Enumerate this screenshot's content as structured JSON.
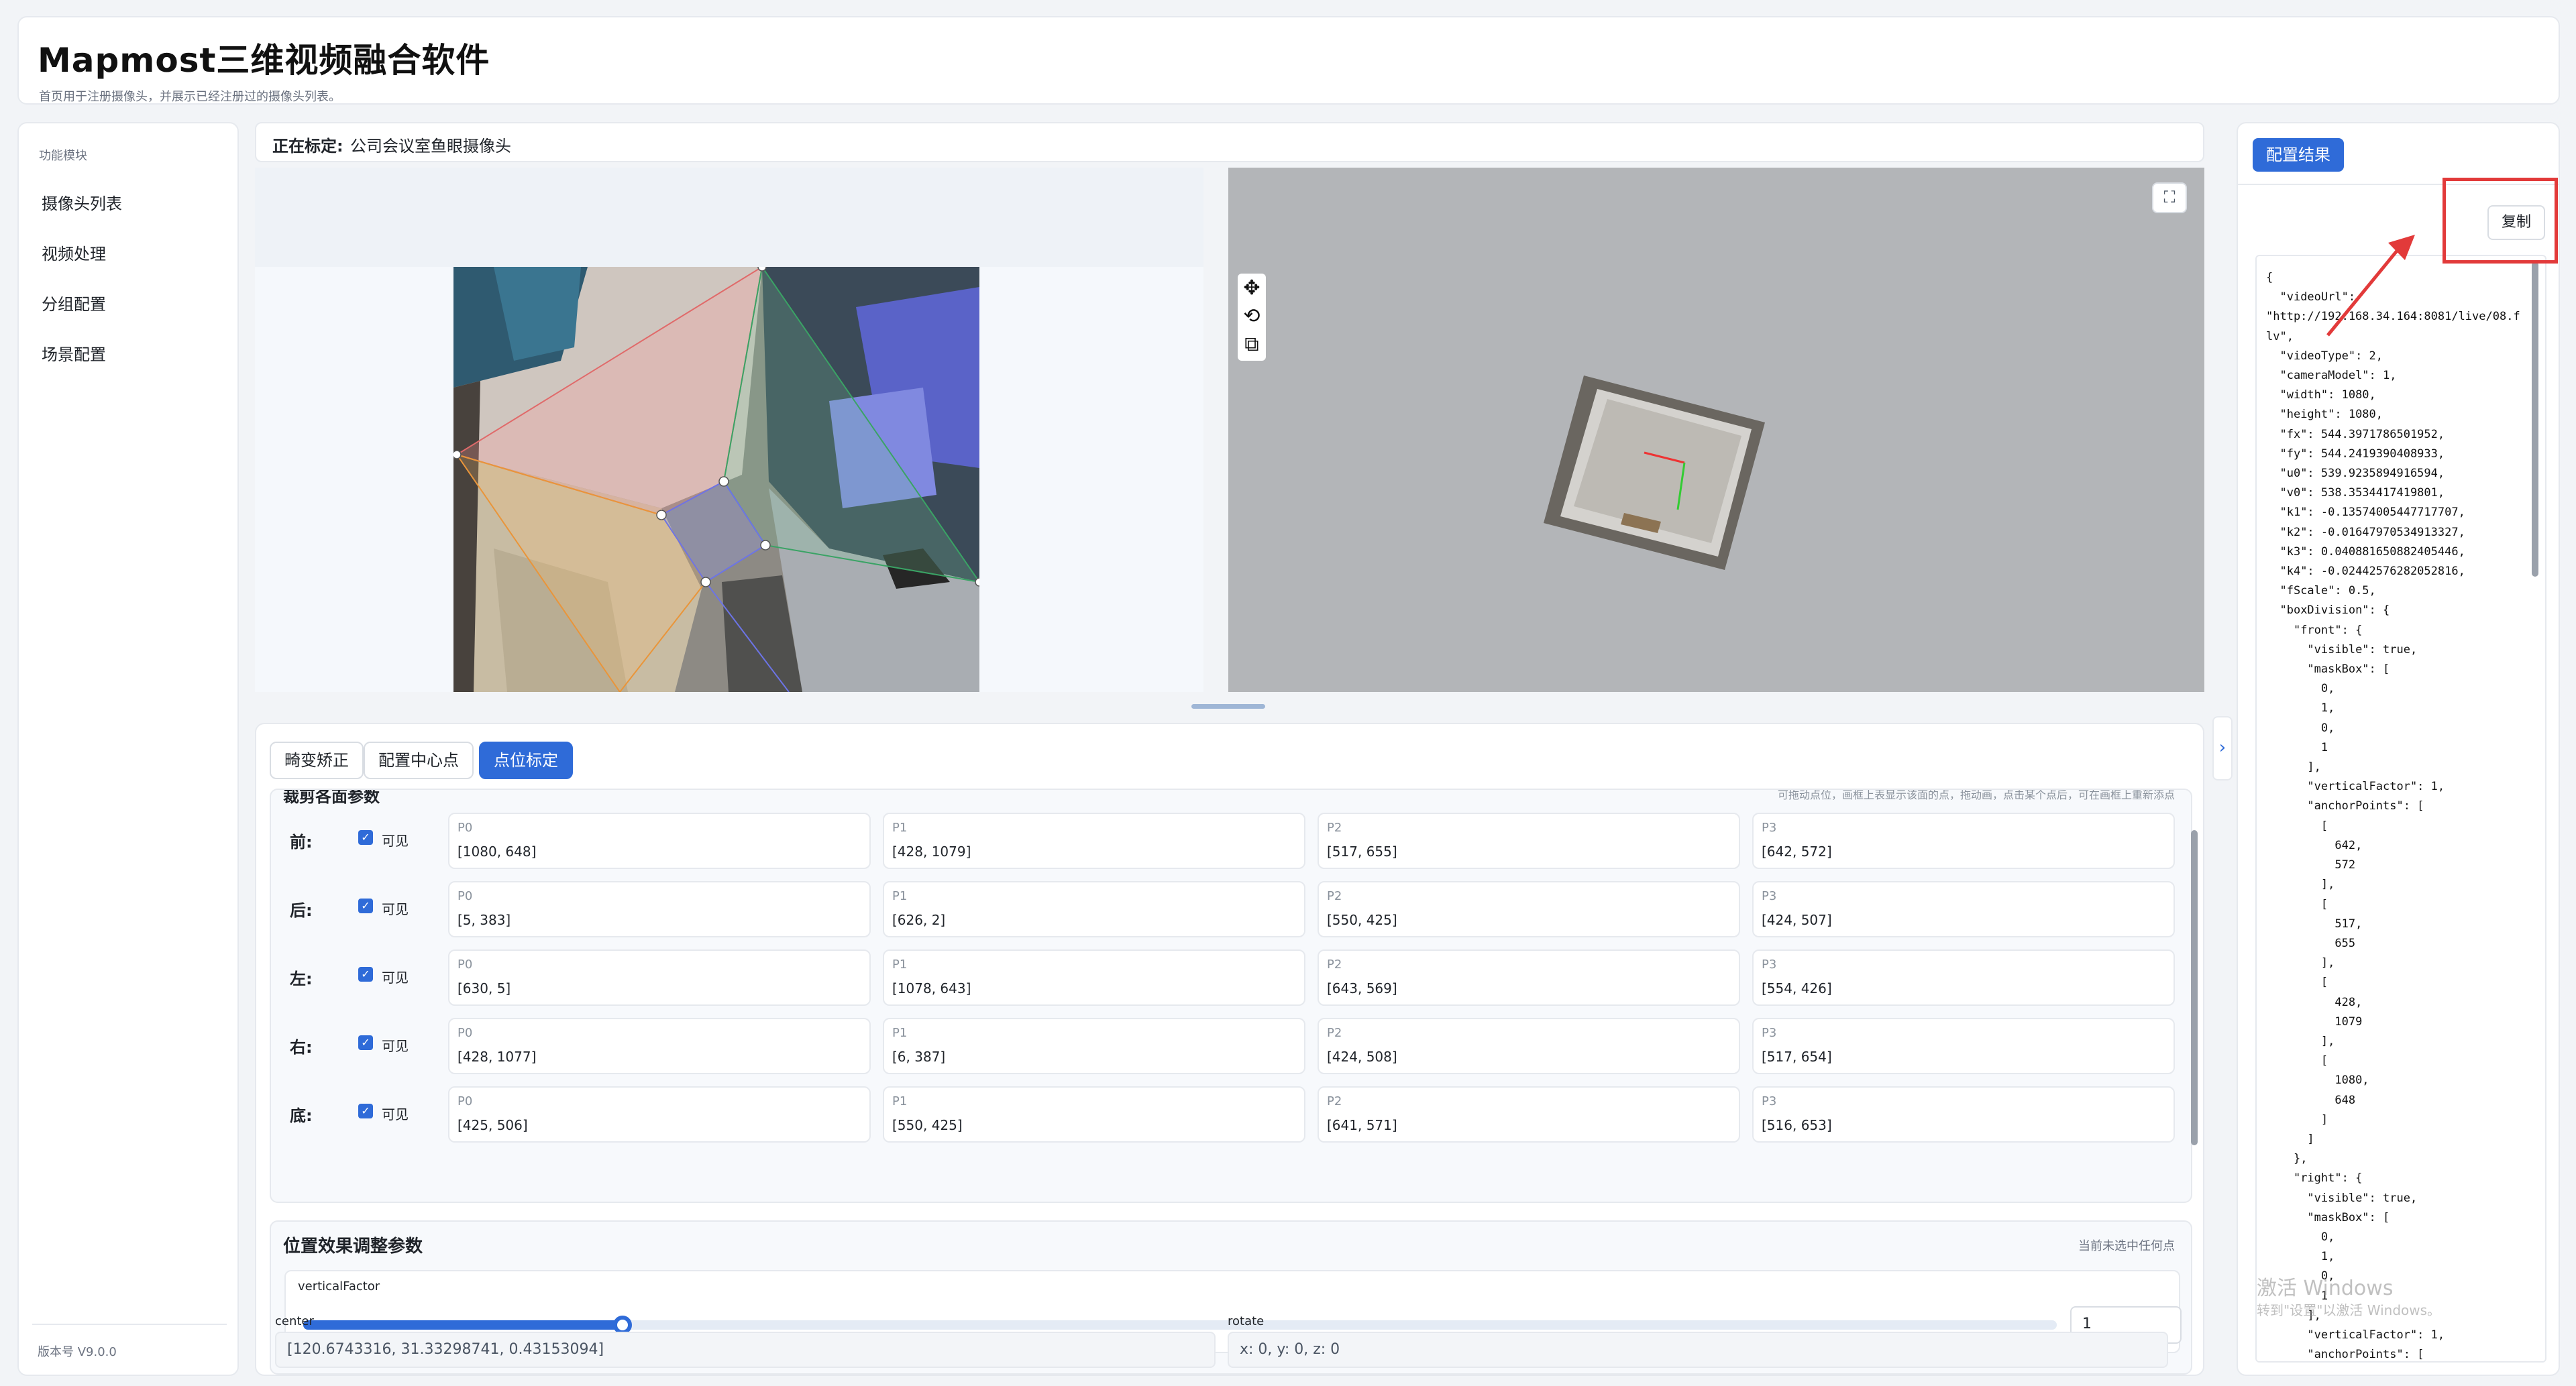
{
  "header": {
    "title": "Mapmost三维视频融合软件",
    "subtitle": "首页用于注册摄像头，并展示已经注册过的摄像头列表。"
  },
  "sidebar": {
    "section_title": "功能模块",
    "items": [
      {
        "label": "摄像头列表"
      },
      {
        "label": "视频处理"
      },
      {
        "label": "分组配置"
      },
      {
        "label": "场景配置"
      }
    ],
    "version": "版本号 V9.0.0"
  },
  "calibrating": {
    "label": "正在标定:",
    "camera_name": "公司会议室鱼眼摄像头"
  },
  "viewer_tools": {
    "move_icon": "move-icon",
    "rotate_icon": "rotate-icon",
    "reset_icon": "reset-view-icon",
    "fullscreen_icon": "fullscreen-icon"
  },
  "tabs": [
    {
      "label": "畸变矫正",
      "active": false
    },
    {
      "label": "配置中心点",
      "active": false
    },
    {
      "label": "点位标定",
      "active": true
    }
  ],
  "params": {
    "title": "裁剪各面参数",
    "hint": "可拖动点位，画框上表显示该面的点，拖动画，点击某个点后，可在画框上重新添点",
    "visible_label": "可见",
    "faces": [
      {
        "label": "前:",
        "visible": true,
        "points": [
          {
            "name": "P0",
            "value": "[1080, 648]"
          },
          {
            "name": "P1",
            "value": "[428, 1079]"
          },
          {
            "name": "P2",
            "value": "[517, 655]"
          },
          {
            "name": "P3",
            "value": "[642, 572]"
          }
        ]
      },
      {
        "label": "后:",
        "visible": true,
        "points": [
          {
            "name": "P0",
            "value": "[5, 383]"
          },
          {
            "name": "P1",
            "value": "[626, 2]"
          },
          {
            "name": "P2",
            "value": "[550, 425]"
          },
          {
            "name": "P3",
            "value": "[424, 507]"
          }
        ]
      },
      {
        "label": "左:",
        "visible": true,
        "points": [
          {
            "name": "P0",
            "value": "[630, 5]"
          },
          {
            "name": "P1",
            "value": "[1078, 643]"
          },
          {
            "name": "P2",
            "value": "[643, 569]"
          },
          {
            "name": "P3",
            "value": "[554, 426]"
          }
        ]
      },
      {
        "label": "右:",
        "visible": true,
        "points": [
          {
            "name": "P0",
            "value": "[428, 1077]"
          },
          {
            "name": "P1",
            "value": "[6, 387]"
          },
          {
            "name": "P2",
            "value": "[424, 508]"
          },
          {
            "name": "P3",
            "value": "[517, 654]"
          }
        ]
      },
      {
        "label": "底:",
        "visible": true,
        "points": [
          {
            "name": "P0",
            "value": "[425, 506]"
          },
          {
            "name": "P1",
            "value": "[550, 425]"
          },
          {
            "name": "P2",
            "value": "[641, 571]"
          },
          {
            "name": "P3",
            "value": "[516, 653]"
          }
        ]
      }
    ]
  },
  "position": {
    "title": "位置效果调整参数",
    "hint": "当前未选中任何点",
    "vertical_factor_label": "verticalFactor",
    "vertical_factor_value": "1",
    "slider_fraction": 0.182,
    "center_label": "center",
    "center_value": "[120.6743316, 31.33298741, 0.43153094]",
    "rotate_label": "rotate",
    "rotate_value": "x: 0, y: 0, z: 0"
  },
  "result": {
    "button_label": "配置结果",
    "copy_label": "复制",
    "json_text": "{\n  \"videoUrl\":\n\"http://192.168.34.164:8081/live/08.flv\",\n  \"videoType\": 2,\n  \"cameraModel\": 1,\n  \"width\": 1080,\n  \"height\": 1080,\n  \"fx\": 544.3971786501952,\n  \"fy\": 544.2419390408933,\n  \"u0\": 539.9235894916594,\n  \"v0\": 538.3534417419801,\n  \"k1\": -0.13574005447717707,\n  \"k2\": -0.01647970534913327,\n  \"k3\": 0.040881650882405446,\n  \"k4\": -0.02442576282052816,\n  \"fScale\": 0.5,\n  \"boxDivision\": {\n    \"front\": {\n      \"visible\": true,\n      \"maskBox\": [\n        0,\n        1,\n        0,\n        1\n      ],\n      \"verticalFactor\": 1,\n      \"anchorPoints\": [\n        [\n          642,\n          572\n        ],\n        [\n          517,\n          655\n        ],\n        [\n          428,\n          1079\n        ],\n        [\n          1080,\n          648\n        ]\n      ]\n    },\n    \"right\": {\n      \"visible\": true,\n      \"maskBox\": [\n        0,\n        1,\n        0,\n        1\n      ],\n      \"verticalFactor\": 1,\n      \"anchorPoints\": ["
  },
  "watermark": {
    "line1": "激活 Windows",
    "line2": "转到\"设置\"以激活 Windows。"
  },
  "colors": {
    "accent": "#2f6bd8",
    "annotation_red": "#e23a3a"
  }
}
